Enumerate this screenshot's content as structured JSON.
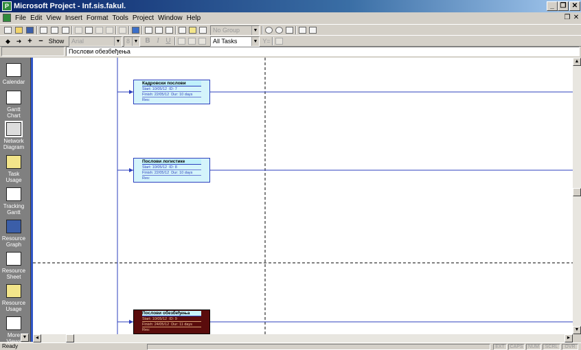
{
  "window": {
    "title": "Microsoft Project - Inf.sis.fakul.",
    "buttons": {
      "minimize": "_",
      "restore": "❐",
      "close": "✕"
    },
    "mdi_buttons": {
      "restore": "❐",
      "close": "✕"
    }
  },
  "menubar": {
    "items": [
      "File",
      "Edit",
      "View",
      "Insert",
      "Format",
      "Tools",
      "Project",
      "Window",
      "Help"
    ]
  },
  "toolbar1": {
    "group_combo": "No Group",
    "icons": [
      "new-icon",
      "open-icon",
      "save-icon",
      "print-icon",
      "print-preview-icon",
      "spelling-icon",
      "cut-icon",
      "copy-icon",
      "paste-icon",
      "format-painter-icon",
      "undo-icon",
      "insert-hyperlink-icon",
      "link-tasks-icon",
      "unlink-tasks-icon",
      "split-task-icon",
      "task-info-icon",
      "task-notes-icon",
      "assign-resources-icon",
      "zoom-in-icon",
      "zoom-out-icon",
      "goto-task-icon",
      "copy-picture-icon",
      "help-icon"
    ]
  },
  "toolbar2": {
    "show_label": "Show",
    "font_combo": "Arial",
    "size_combo": "8",
    "bold": "B",
    "italic": "I",
    "underline": "U",
    "filter_combo": "All Tasks",
    "autofilter": "Y=",
    "icons": [
      "indent-left-icon",
      "indent-right-icon",
      "add-icon",
      "remove-icon",
      "align-left-icon",
      "align-center-icon",
      "align-right-icon",
      "gantt-wizard-icon"
    ]
  },
  "entrybar": {
    "value": "Послови обезбеђења"
  },
  "viewbar": {
    "items": [
      {
        "label": "Calendar",
        "icon": "calendar-icon"
      },
      {
        "label": "Gantt Chart",
        "icon": "gantt-chart-icon"
      },
      {
        "label": "Network Diagram",
        "icon": "network-diagram-icon",
        "active": true
      },
      {
        "label": "Task Usage",
        "icon": "task-usage-icon"
      },
      {
        "label": "Tracking Gantt",
        "icon": "tracking-gantt-icon"
      },
      {
        "label": "Resource Graph",
        "icon": "resource-graph-icon"
      },
      {
        "label": "Resource Sheet",
        "icon": "resource-sheet-icon"
      },
      {
        "label": "Resource Usage",
        "icon": "resource-usage-icon"
      },
      {
        "label": "More Views",
        "icon": "more-views-icon"
      }
    ]
  },
  "network": {
    "nodes": [
      {
        "title": "Кадровски послови",
        "start": "Start: 10/05/12",
        "id": "ID: 7",
        "finish": "Finish: 22/05/12",
        "dur": "Dur: 10 days",
        "res": "Res:",
        "critical": false
      },
      {
        "title": "Послови логистике",
        "start": "Start: 10/05/12",
        "id": "ID: 8",
        "finish": "Finish: 22/05/12",
        "dur": "Dur: 10 days",
        "res": "Res:",
        "critical": false
      },
      {
        "title": "Послови обезбеђења",
        "start": "Start: 10/05/12",
        "id": "ID: 9",
        "finish": "Finish: 24/05/12",
        "dur": "Dur: 11 days",
        "res": "Res:",
        "critical": true
      }
    ],
    "colors": {
      "link": "#2b3fbd",
      "noncritical_fill": "#d4f4fb",
      "critical_fill": "#5a0c0c"
    }
  },
  "statusbar": {
    "ready": "Ready",
    "indicators": [
      "EXT",
      "CAPS",
      "NUM",
      "SCRL",
      "OVR"
    ]
  }
}
